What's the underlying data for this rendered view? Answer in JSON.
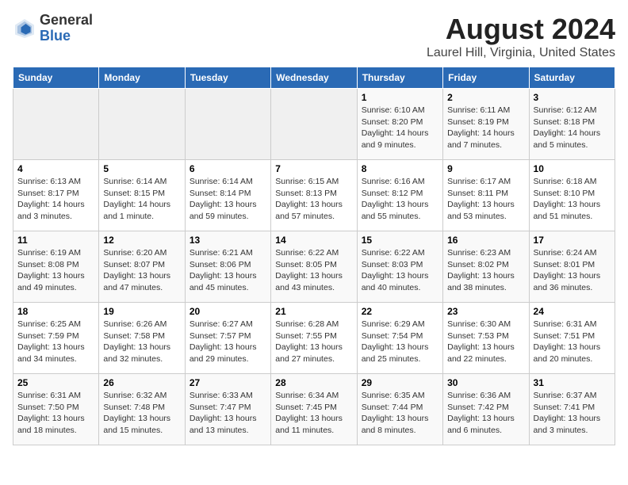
{
  "header": {
    "logo_general": "General",
    "logo_blue": "Blue",
    "month_title": "August 2024",
    "location": "Laurel Hill, Virginia, United States"
  },
  "weekdays": [
    "Sunday",
    "Monday",
    "Tuesday",
    "Wednesday",
    "Thursday",
    "Friday",
    "Saturday"
  ],
  "weeks": [
    [
      {
        "day": "",
        "info": ""
      },
      {
        "day": "",
        "info": ""
      },
      {
        "day": "",
        "info": ""
      },
      {
        "day": "",
        "info": ""
      },
      {
        "day": "1",
        "info": "Sunrise: 6:10 AM\nSunset: 8:20 PM\nDaylight: 14 hours\nand 9 minutes."
      },
      {
        "day": "2",
        "info": "Sunrise: 6:11 AM\nSunset: 8:19 PM\nDaylight: 14 hours\nand 7 minutes."
      },
      {
        "day": "3",
        "info": "Sunrise: 6:12 AM\nSunset: 8:18 PM\nDaylight: 14 hours\nand 5 minutes."
      }
    ],
    [
      {
        "day": "4",
        "info": "Sunrise: 6:13 AM\nSunset: 8:17 PM\nDaylight: 14 hours\nand 3 minutes."
      },
      {
        "day": "5",
        "info": "Sunrise: 6:14 AM\nSunset: 8:15 PM\nDaylight: 14 hours\nand 1 minute."
      },
      {
        "day": "6",
        "info": "Sunrise: 6:14 AM\nSunset: 8:14 PM\nDaylight: 13 hours\nand 59 minutes."
      },
      {
        "day": "7",
        "info": "Sunrise: 6:15 AM\nSunset: 8:13 PM\nDaylight: 13 hours\nand 57 minutes."
      },
      {
        "day": "8",
        "info": "Sunrise: 6:16 AM\nSunset: 8:12 PM\nDaylight: 13 hours\nand 55 minutes."
      },
      {
        "day": "9",
        "info": "Sunrise: 6:17 AM\nSunset: 8:11 PM\nDaylight: 13 hours\nand 53 minutes."
      },
      {
        "day": "10",
        "info": "Sunrise: 6:18 AM\nSunset: 8:10 PM\nDaylight: 13 hours\nand 51 minutes."
      }
    ],
    [
      {
        "day": "11",
        "info": "Sunrise: 6:19 AM\nSunset: 8:08 PM\nDaylight: 13 hours\nand 49 minutes."
      },
      {
        "day": "12",
        "info": "Sunrise: 6:20 AM\nSunset: 8:07 PM\nDaylight: 13 hours\nand 47 minutes."
      },
      {
        "day": "13",
        "info": "Sunrise: 6:21 AM\nSunset: 8:06 PM\nDaylight: 13 hours\nand 45 minutes."
      },
      {
        "day": "14",
        "info": "Sunrise: 6:22 AM\nSunset: 8:05 PM\nDaylight: 13 hours\nand 43 minutes."
      },
      {
        "day": "15",
        "info": "Sunrise: 6:22 AM\nSunset: 8:03 PM\nDaylight: 13 hours\nand 40 minutes."
      },
      {
        "day": "16",
        "info": "Sunrise: 6:23 AM\nSunset: 8:02 PM\nDaylight: 13 hours\nand 38 minutes."
      },
      {
        "day": "17",
        "info": "Sunrise: 6:24 AM\nSunset: 8:01 PM\nDaylight: 13 hours\nand 36 minutes."
      }
    ],
    [
      {
        "day": "18",
        "info": "Sunrise: 6:25 AM\nSunset: 7:59 PM\nDaylight: 13 hours\nand 34 minutes."
      },
      {
        "day": "19",
        "info": "Sunrise: 6:26 AM\nSunset: 7:58 PM\nDaylight: 13 hours\nand 32 minutes."
      },
      {
        "day": "20",
        "info": "Sunrise: 6:27 AM\nSunset: 7:57 PM\nDaylight: 13 hours\nand 29 minutes."
      },
      {
        "day": "21",
        "info": "Sunrise: 6:28 AM\nSunset: 7:55 PM\nDaylight: 13 hours\nand 27 minutes."
      },
      {
        "day": "22",
        "info": "Sunrise: 6:29 AM\nSunset: 7:54 PM\nDaylight: 13 hours\nand 25 minutes."
      },
      {
        "day": "23",
        "info": "Sunrise: 6:30 AM\nSunset: 7:53 PM\nDaylight: 13 hours\nand 22 minutes."
      },
      {
        "day": "24",
        "info": "Sunrise: 6:31 AM\nSunset: 7:51 PM\nDaylight: 13 hours\nand 20 minutes."
      }
    ],
    [
      {
        "day": "25",
        "info": "Sunrise: 6:31 AM\nSunset: 7:50 PM\nDaylight: 13 hours\nand 18 minutes."
      },
      {
        "day": "26",
        "info": "Sunrise: 6:32 AM\nSunset: 7:48 PM\nDaylight: 13 hours\nand 15 minutes."
      },
      {
        "day": "27",
        "info": "Sunrise: 6:33 AM\nSunset: 7:47 PM\nDaylight: 13 hours\nand 13 minutes."
      },
      {
        "day": "28",
        "info": "Sunrise: 6:34 AM\nSunset: 7:45 PM\nDaylight: 13 hours\nand 11 minutes."
      },
      {
        "day": "29",
        "info": "Sunrise: 6:35 AM\nSunset: 7:44 PM\nDaylight: 13 hours\nand 8 minutes."
      },
      {
        "day": "30",
        "info": "Sunrise: 6:36 AM\nSunset: 7:42 PM\nDaylight: 13 hours\nand 6 minutes."
      },
      {
        "day": "31",
        "info": "Sunrise: 6:37 AM\nSunset: 7:41 PM\nDaylight: 13 hours\nand 3 minutes."
      }
    ]
  ]
}
